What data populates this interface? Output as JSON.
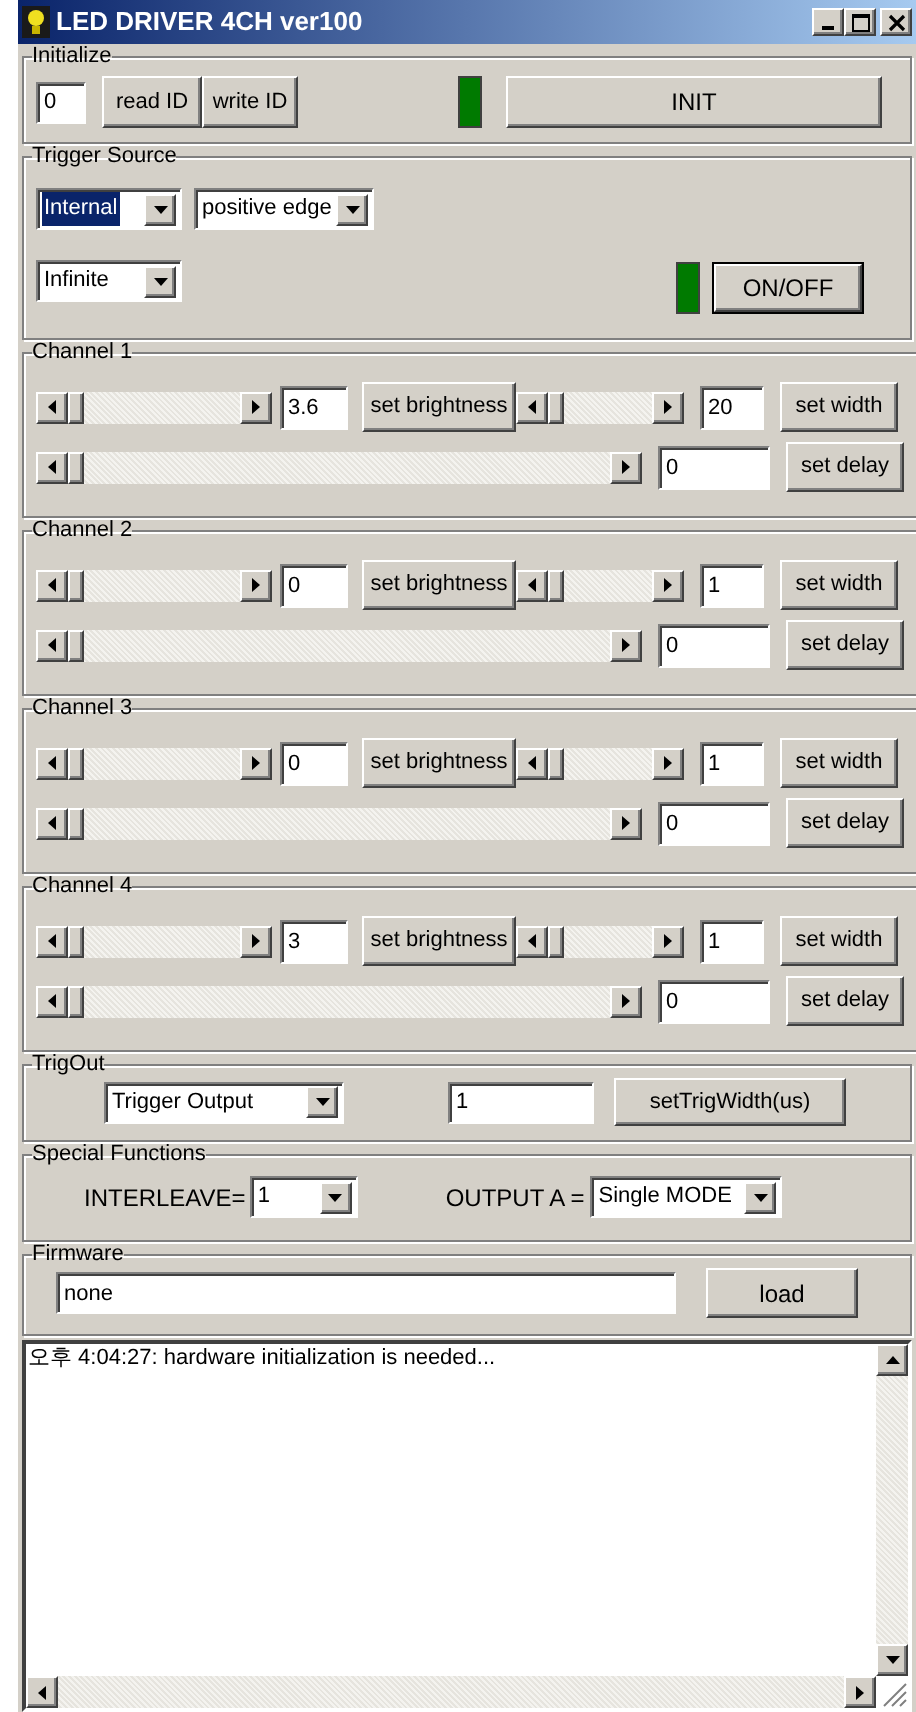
{
  "window": {
    "title": "LED DRIVER 4CH ver100"
  },
  "initialize": {
    "title": "Initialize",
    "id_value": "0",
    "read_button": "read ID",
    "write_button": "write ID",
    "indicator_on": true,
    "init_button": "INIT"
  },
  "trigger_source": {
    "title": "Trigger Source",
    "source": {
      "value": "Internal",
      "focused": true
    },
    "edge": {
      "value": "positive edge",
      "focused": false
    },
    "count": {
      "value": "Infinite",
      "focused": false
    },
    "indicator_on": true,
    "onoff_button": "ON/OFF"
  },
  "channels": [
    {
      "title": "Channel 1",
      "brightness": {
        "level": 0,
        "value": "3.6",
        "button": "set brightness"
      },
      "width": {
        "level": 0,
        "value": "20",
        "button": "set width"
      },
      "delay": {
        "level": 0,
        "value": "0",
        "button": "set delay"
      }
    },
    {
      "title": "Channel 2",
      "brightness": {
        "level": 0,
        "value": "0",
        "button": "set brightness"
      },
      "width": {
        "level": 0,
        "value": "1",
        "button": "set width"
      },
      "delay": {
        "level": 0,
        "value": "0",
        "button": "set delay"
      }
    },
    {
      "title": "Channel 3",
      "brightness": {
        "level": 0,
        "value": "0",
        "button": "set brightness"
      },
      "width": {
        "level": 0,
        "value": "1",
        "button": "set width"
      },
      "delay": {
        "level": 0,
        "value": "0",
        "button": "set delay"
      }
    },
    {
      "title": "Channel 4",
      "brightness": {
        "level": 0,
        "value": "3",
        "button": "set brightness"
      },
      "width": {
        "level": 0,
        "value": "1",
        "button": "set width"
      },
      "delay": {
        "level": 0,
        "value": "0",
        "button": "set delay"
      }
    }
  ],
  "trigout": {
    "title": "TrigOut",
    "mode": "Trigger Output",
    "width_value": "1",
    "button": "setTrigWidth(us)"
  },
  "special_functions": {
    "title": "Special Functions",
    "interleave_label": "INTERLEAVE=",
    "interleave": "1",
    "output_label": "OUTPUT A =",
    "output": "Single MODE"
  },
  "firmware": {
    "title": "Firmware",
    "path": "none",
    "button": "load"
  },
  "log": {
    "lines": [
      "오후 4:04:27:  hardware initialization is needed..."
    ]
  }
}
